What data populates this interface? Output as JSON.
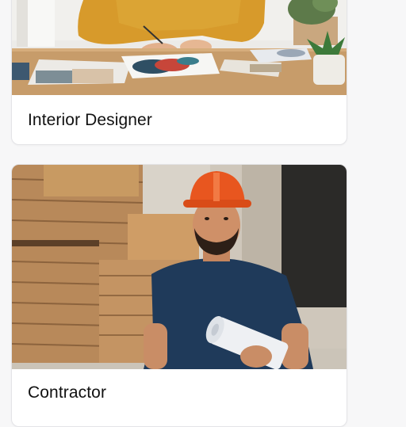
{
  "cards": [
    {
      "title": "Interior Designer",
      "image": "photo of an interior designer at a desk with fabric swatches",
      "icon": "photo-interior-designer"
    },
    {
      "title": "Contractor",
      "image": "photo of a contractor in an orange hard hat holding rolled blueprints",
      "icon": "photo-contractor"
    }
  ],
  "colors": {
    "page_background": "#f7f7f8",
    "card_background": "#ffffff",
    "card_border": "#e4e4e7",
    "title_text": "#111111",
    "sweater": "#d79a2b",
    "hard_hat": "#e8561f",
    "shirt": "#1f3a5a",
    "lumber": "#c89a62"
  }
}
